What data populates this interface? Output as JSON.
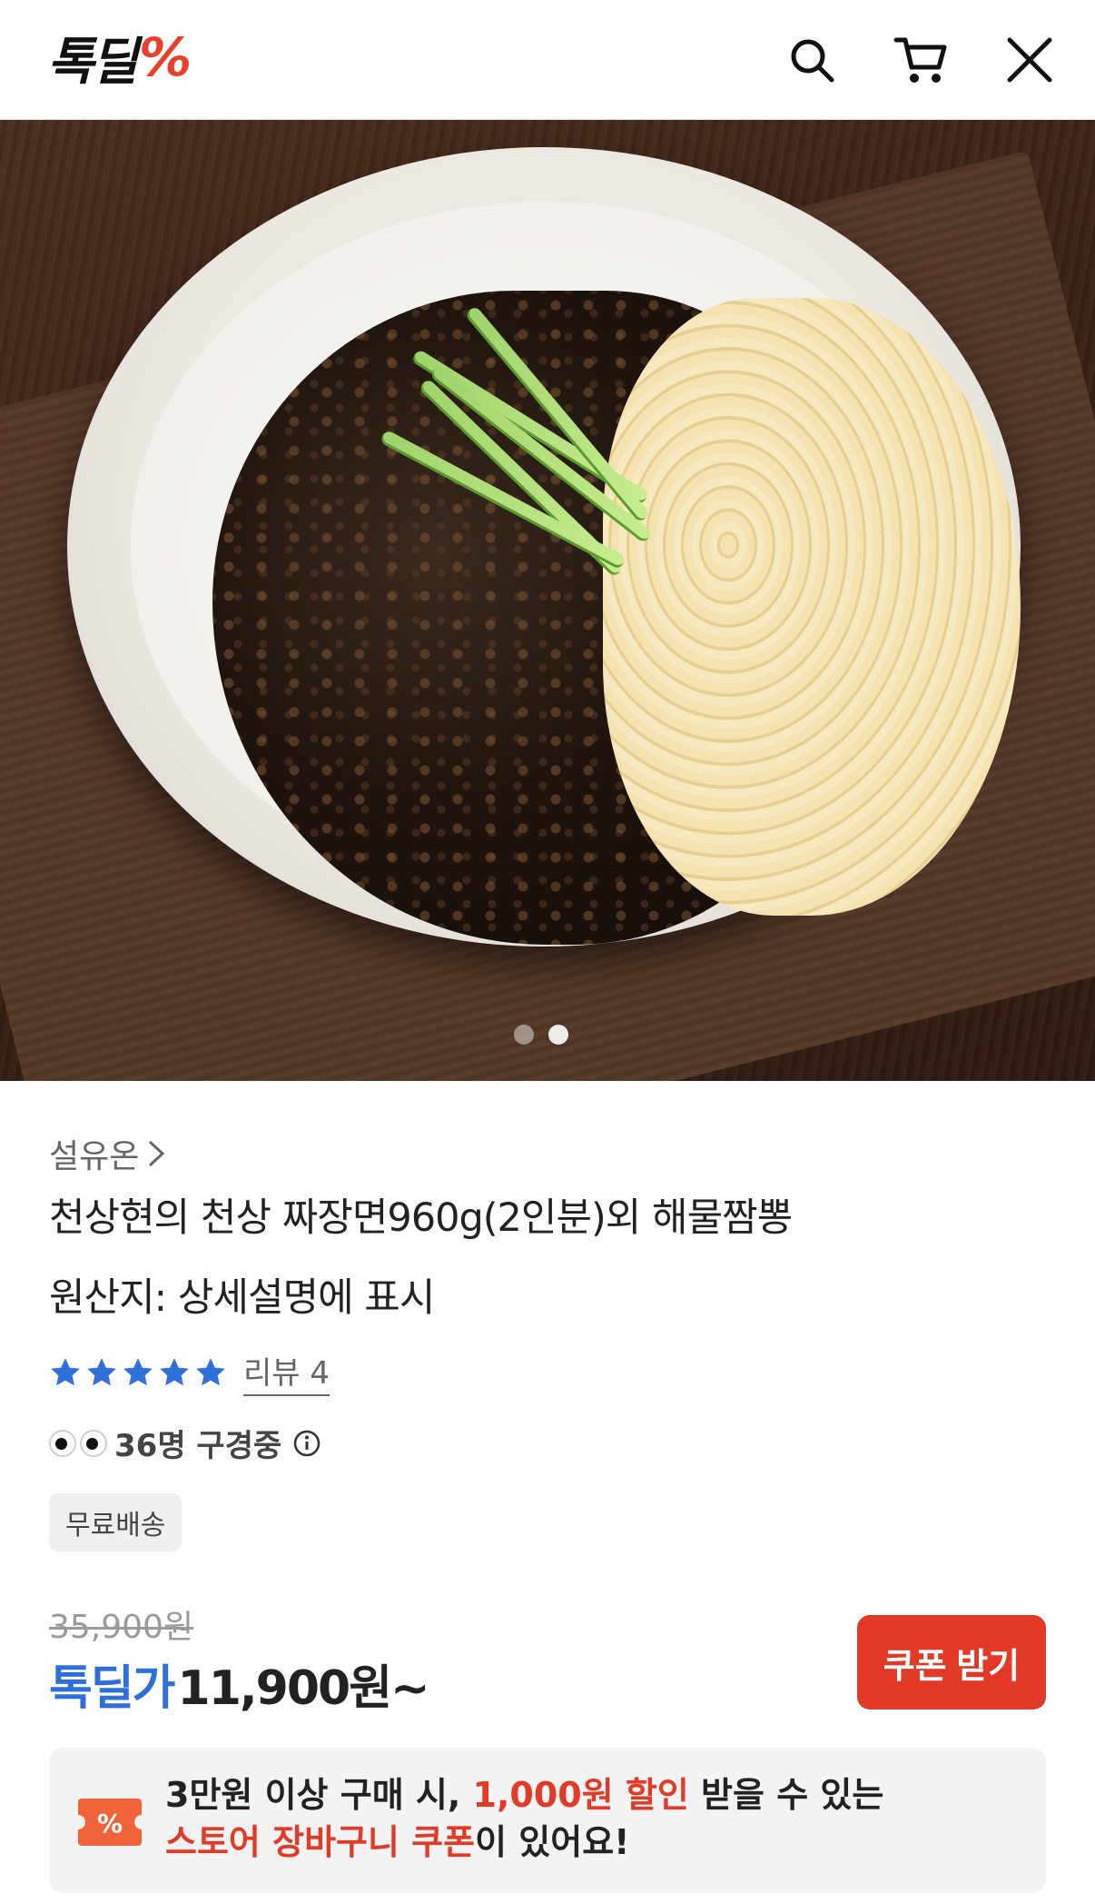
{
  "header": {
    "logo_text": "톡딜",
    "logo_mark": "%",
    "icons": [
      "search-icon",
      "cart-icon",
      "close-icon"
    ]
  },
  "hero": {
    "slide_count": 2,
    "active_slide": 1
  },
  "product": {
    "seller": "설유온",
    "title": "천상현의 천상 짜장면960g(2인분)외 해물짬뽕",
    "origin": "원산지: 상세설명에 표시",
    "rating_stars": 5,
    "review_label": "리뷰 4",
    "viewers": "36명 구경중",
    "badge": "무료배송"
  },
  "price": {
    "original": "35,900원",
    "deal_label": "톡딜가",
    "deal_price": "11,900원~",
    "coupon_button": "쿠폰 받기"
  },
  "promo": {
    "line1_a": "3만원 이상 구매 시, ",
    "line1_highlight": "1,000원 할인",
    "line1_b": " 받을 수 있는",
    "line2_highlight": "스토어 장바구니 쿠폰",
    "line2_b": "이 있어요!"
  },
  "colors": {
    "accent_red": "#e23a26",
    "deal_blue": "#2f6fdb",
    "star_blue": "#2f6fdb"
  }
}
